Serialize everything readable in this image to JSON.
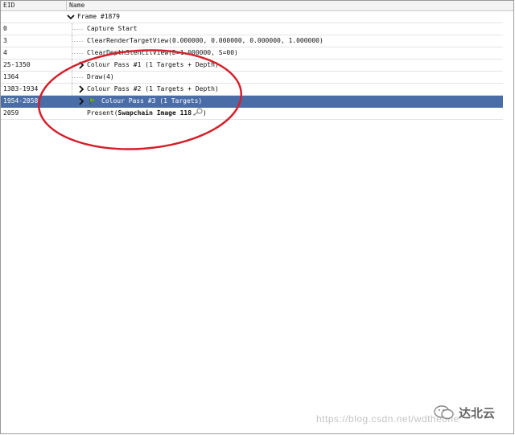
{
  "header": {
    "col_eid": "EID",
    "col_name": "Name"
  },
  "rows": [
    {
      "eid": "",
      "name": "Frame #1879",
      "expander": "chevron-down-icon"
    },
    {
      "eid": "0",
      "name": "Capture Start"
    },
    {
      "eid": "3",
      "name": "ClearRenderTargetView(0.000000, 0.000000, 0.000000, 1.000000)"
    },
    {
      "eid": "4",
      "name": "ClearDepthStencilView(D=1.000000, S=00)"
    },
    {
      "eid": "25-1350",
      "name": "Colour Pass #1 (1 Targets + Depth)",
      "expander": "chevron-right-icon"
    },
    {
      "eid": "1364",
      "name": "Draw(4)"
    },
    {
      "eid": "1383-1934",
      "name": "Colour Pass #2 (1 Targets + Depth)",
      "expander": "chevron-right-icon"
    },
    {
      "eid": "1954-2058",
      "name": "Colour Pass #3 (1 Targets)",
      "expander": "chevron-right-icon",
      "icon": "green-flag-icon",
      "selected": true
    },
    {
      "eid": "2059",
      "name_prefix": "Present(",
      "name_bold": "Swapchain Image 118",
      "name_suffix": ")",
      "icon": "key-link-icon"
    }
  ],
  "watermark": {
    "url_text": "https://blog.csdn.net/wdtheone",
    "brand": "达北云"
  },
  "colors": {
    "selected_row": "#4a6da7",
    "annotation_circle": "#d4202a",
    "flag": "#6aa51e"
  }
}
